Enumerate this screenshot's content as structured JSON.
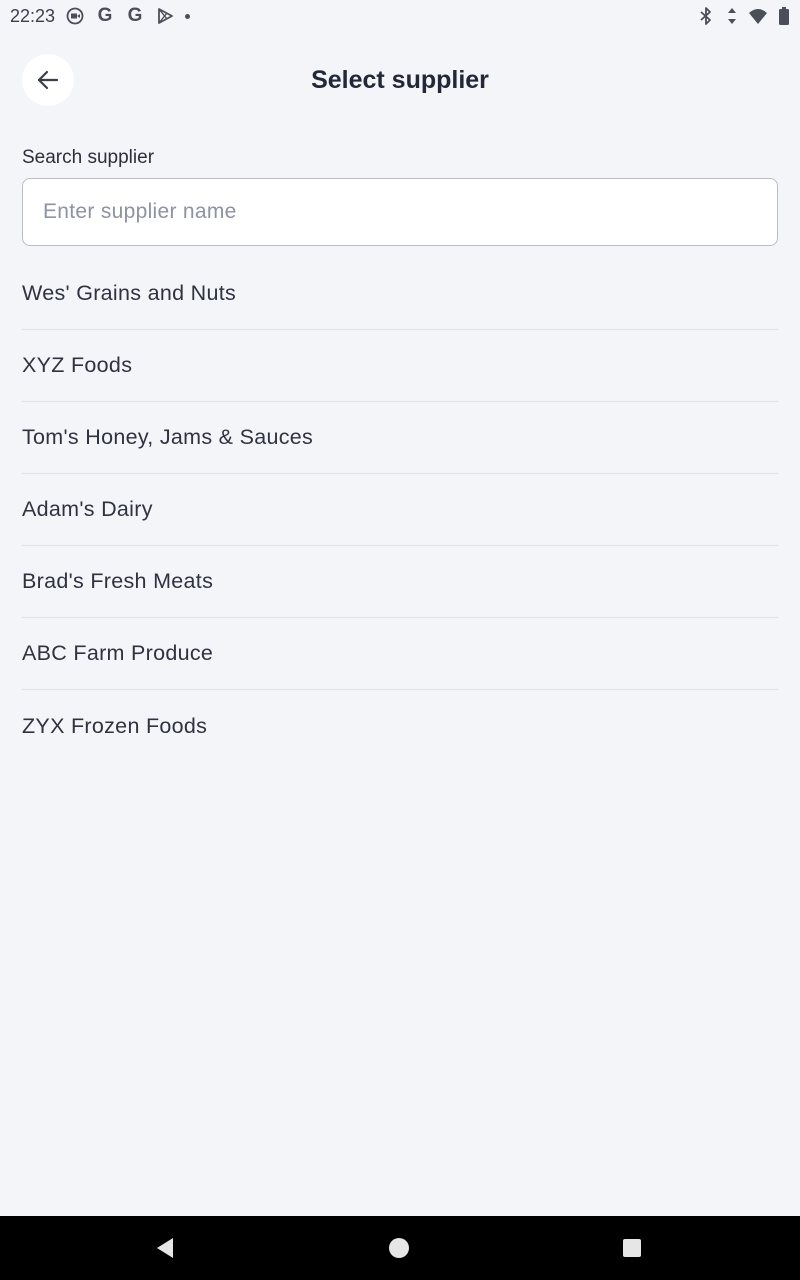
{
  "status_bar": {
    "time": "22:23",
    "left_icons": [
      "camera-off-icon",
      "google-icon",
      "google-icon",
      "play-store-icon",
      "dot-icon"
    ],
    "right_icons": [
      "bluetooth-icon",
      "data-arrows-icon",
      "wifi-icon",
      "battery-icon"
    ],
    "g_letter": "G"
  },
  "header": {
    "title": "Select supplier",
    "back_icon": "arrow-left-icon"
  },
  "search": {
    "label": "Search supplier",
    "placeholder": "Enter supplier name",
    "value": ""
  },
  "suppliers": [
    "Wes' Grains and Nuts",
    "XYZ Foods",
    "Tom's Honey, Jams & Sauces",
    "Adam's Dairy",
    "Brad's Fresh Meats",
    "ABC Farm Produce",
    "ZYX Frozen Foods"
  ],
  "nav_bar": {
    "buttons": [
      "back-triangle-icon",
      "home-circle-icon",
      "recents-square-icon"
    ]
  },
  "colors": {
    "background": "#f4f5f9",
    "title": "#232838",
    "text": "#2f3340",
    "placeholder": "#8d93a3",
    "divider": "#dfe1e7",
    "nav_bar": "#000000"
  }
}
